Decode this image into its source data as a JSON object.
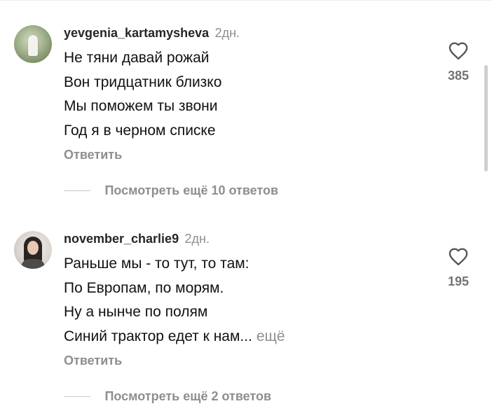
{
  "comments": [
    {
      "username": "yevgenia_kartamysheva",
      "time": "2дн.",
      "lines": [
        "Не тяни давай рожай",
        "Вон тридцатник близко",
        "Мы поможем ты звони",
        "Год я в черном списке"
      ],
      "reply_label": "Ответить",
      "view_replies": "Посмотреть ещё 10 ответов",
      "likes": "385",
      "avatar_icon": "avatar-photo"
    },
    {
      "username": "november_charlie9",
      "time": "2дн.",
      "lines": [
        "Раньше мы - то тут, то там:",
        "По Европам, по морям.",
        "Ну а нынче по полям",
        "Синий трактор едет к нам..."
      ],
      "more_label": "ещё",
      "reply_label": "Ответить",
      "view_replies": "Посмотреть ещё 2 ответов",
      "likes": "195",
      "avatar_icon": "avatar-photo"
    }
  ],
  "icons": {
    "like": "heart-outline-icon"
  },
  "colors": {
    "text": "#111111",
    "secondary": "#8e8e8e",
    "count": "#737373"
  }
}
